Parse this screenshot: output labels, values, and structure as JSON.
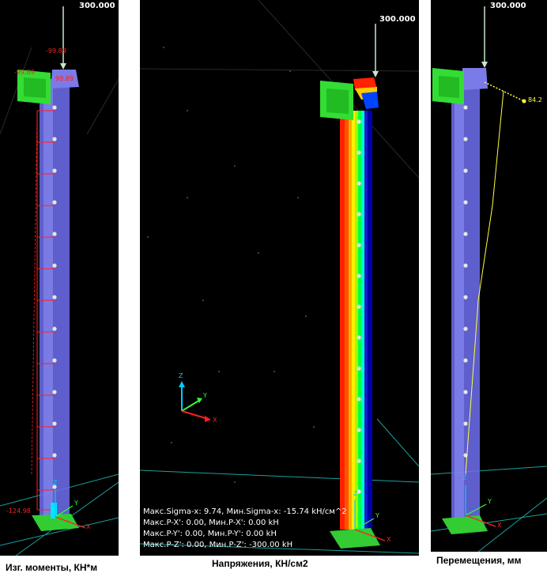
{
  "panels": {
    "left": {
      "caption": "Изг. моменты, КН*м",
      "load": "300.000",
      "values": [
        "-99.89",
        "-99.89",
        "99.89",
        "-124.98"
      ],
      "axis": {
        "z": "Z",
        "y": "Y",
        "x": "X"
      }
    },
    "middle": {
      "caption": "Напряжения, КН/см2",
      "load": "300.000",
      "triad": {
        "z": "Z",
        "y": "Y",
        "x": "X"
      },
      "axis": {
        "z": "Z",
        "y": "Y",
        "x": "X"
      },
      "info": [
        "Макс.Sigma-x: 9.74, Мин.Sigma-x: -15.74 kH/см^2",
        "Макс.P-X': 0.00, Мин.P-X': 0.00 kH",
        "Макс.P-Y': 0.00, Мин.P-Y': 0.00 kH",
        "Макс.P-Z': 0.00, Мин.P-Z': -300.00 kH"
      ]
    },
    "right": {
      "caption": "Перемещения, мм",
      "load": "300.000",
      "value": "84.2",
      "axis": {
        "z": "Z",
        "y": "Y",
        "x": "X"
      }
    }
  },
  "colors": {
    "background": "#000000",
    "column": "#6e6ef0",
    "plate": "#33dd33",
    "moment": "#ff2020",
    "displacement": "#ffff40",
    "grid": "#1aa0a0"
  }
}
